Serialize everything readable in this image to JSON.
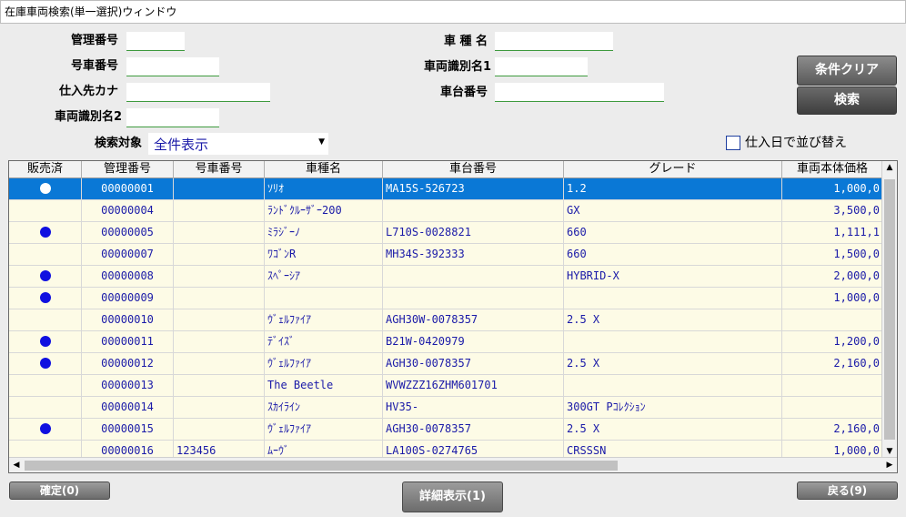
{
  "window": {
    "title": "在庫車両検索(単一選択)ウィンドウ"
  },
  "form": {
    "kanri_label": "管理番号",
    "gosha_label": "号車番号",
    "shiire_label": "仕入先カナ",
    "shikibetsu2_label": "車両識別名2",
    "shamei_label": "車 種 名",
    "shikibetsu1_label": "車両識別名1",
    "shadai_label": "車台番号",
    "target_label": "検索対象",
    "target_value": "全件表示",
    "sort_label": "仕入日で並び替え"
  },
  "buttons": {
    "clear": "条件クリア",
    "search": "検索",
    "confirm": "確定(0)",
    "detail": "詳細表示(1)",
    "back": "戻る(9)"
  },
  "table": {
    "headers": [
      "販売済",
      "管理番号",
      "号車番号",
      "車種名",
      "車台番号",
      "グレード",
      "車両本体価格"
    ],
    "rows": [
      {
        "sold": "white",
        "kanri": "00000001",
        "gosha": "",
        "shamei": "ｿﾘｵ",
        "shadai": "MA15S-526723",
        "grade": "1.2",
        "price": "1,000,0"
      },
      {
        "sold": "",
        "kanri": "00000004",
        "gosha": "",
        "shamei": "ﾗﾝﾄﾞｸﾙｰｻﾞｰ200",
        "shadai": "",
        "grade": "GX",
        "price": "3,500,0"
      },
      {
        "sold": "blue",
        "kanri": "00000005",
        "gosha": "",
        "shamei": "ﾐﾗｼﾞｰﾉ",
        "shadai": "L710S-0028821",
        "grade": "660",
        "price": "1,111,1"
      },
      {
        "sold": "",
        "kanri": "00000007",
        "gosha": "",
        "shamei": "ﾜｺﾞﾝR",
        "shadai": "MH34S-392333",
        "grade": "660",
        "price": "1,500,0"
      },
      {
        "sold": "blue",
        "kanri": "00000008",
        "gosha": "",
        "shamei": "ｽﾍﾟｰｼｱ",
        "shadai": "",
        "grade": "HYBRID-X",
        "price": "2,000,0"
      },
      {
        "sold": "blue",
        "kanri": "00000009",
        "gosha": "",
        "shamei": "",
        "shadai": "",
        "grade": "",
        "price": "1,000,0"
      },
      {
        "sold": "",
        "kanri": "00000010",
        "gosha": "",
        "shamei": "ｳﾞｪﾙﾌｧｲｱ",
        "shadai": "AGH30W-0078357",
        "grade": "2.5 X",
        "price": ""
      },
      {
        "sold": "blue",
        "kanri": "00000011",
        "gosha": "",
        "shamei": "ﾃﾞｲｽﾞ",
        "shadai": "B21W-0420979",
        "grade": "",
        "price": "1,200,0"
      },
      {
        "sold": "blue",
        "kanri": "00000012",
        "gosha": "",
        "shamei": "ｳﾞｪﾙﾌｧｲｱ",
        "shadai": "AGH30-0078357",
        "grade": "2.5 X",
        "price": "2,160,0"
      },
      {
        "sold": "",
        "kanri": "00000013",
        "gosha": "",
        "shamei": "The Beetle",
        "shadai": "WVWZZZ16ZHM601701",
        "grade": "",
        "price": ""
      },
      {
        "sold": "",
        "kanri": "00000014",
        "gosha": "",
        "shamei": "ｽｶｲﾗｲﾝ",
        "shadai": "HV35-",
        "grade": "300GT Pｺﾚｸｼｮﾝ",
        "price": ""
      },
      {
        "sold": "blue",
        "kanri": "00000015",
        "gosha": "",
        "shamei": "ｳﾞｪﾙﾌｧｲｱ",
        "shadai": "AGH30-0078357",
        "grade": "2.5 X",
        "price": "2,160,0"
      },
      {
        "sold": "",
        "kanri": "00000016",
        "gosha": "123456",
        "shamei": "ﾑｰｳﾞ",
        "shadai": "LA100S-0274765",
        "grade": "CRSSSN",
        "price": "1,000,0"
      }
    ]
  }
}
